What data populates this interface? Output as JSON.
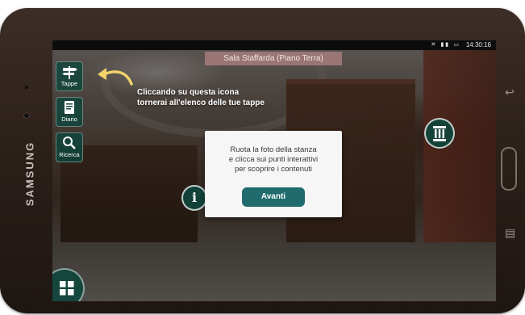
{
  "device": {
    "brand": "SAMSUNG"
  },
  "statusbar": {
    "time": "14:30:16",
    "icons": "✕ ▮▮ ▭"
  },
  "room": {
    "title": "Sala Staffarda (Piano Terra)"
  },
  "nav": [
    {
      "label": "Tappe",
      "icon": "signpost-icon"
    },
    {
      "label": "Diario",
      "icon": "diary-icon"
    },
    {
      "label": "Ricerca",
      "icon": "search-icon"
    }
  ],
  "hint": {
    "line1": "Cliccando su questa icona",
    "line2": "tornerai all'elenco delle tue tappe"
  },
  "modal": {
    "line1": "Ruota la foto della stanza",
    "line2": "e clicca sui punti interattivi",
    "line3": "per scoprire i contenuti",
    "button": "Avanti"
  },
  "hotspots": {
    "info_label": "i"
  },
  "colors": {
    "accent": "#1f6b6d",
    "panel": "#0f463c"
  }
}
